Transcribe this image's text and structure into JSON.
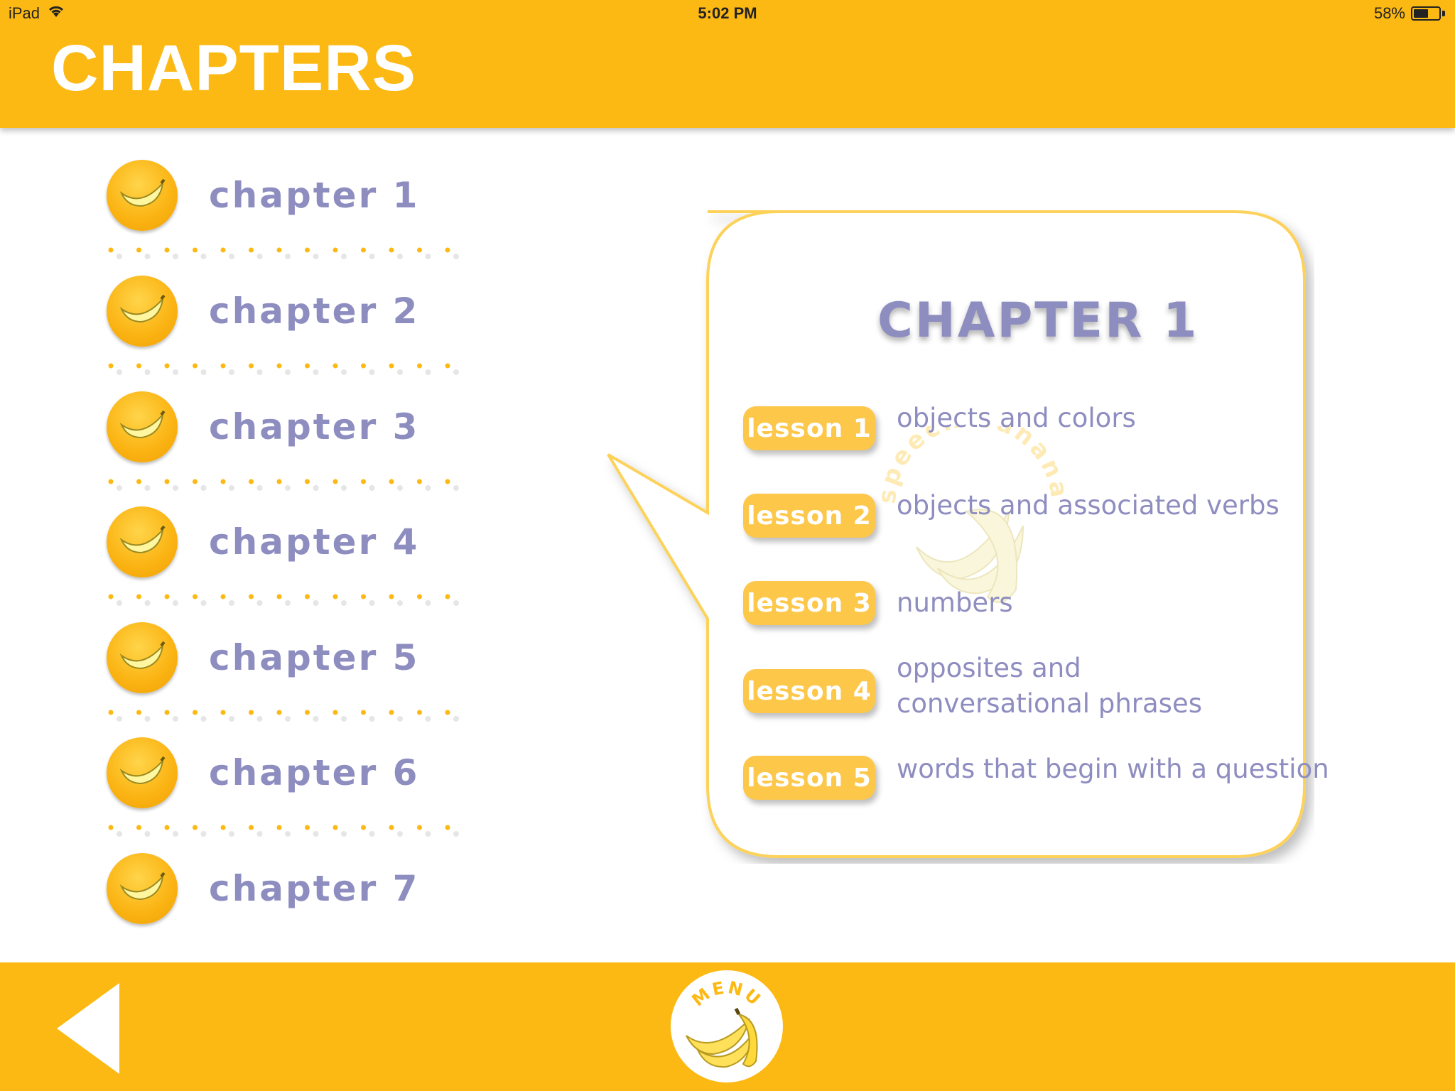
{
  "status_bar": {
    "device": "iPad",
    "time": "5:02 PM",
    "battery": "58%",
    "battery_level": 0.58
  },
  "header": {
    "title": "CHAPTERS",
    "background_color": "#fdb913"
  },
  "chapters": [
    {
      "label": "chapter 1",
      "icon": "banana-icon"
    },
    {
      "label": "chapter 2",
      "icon": "banana-icon"
    },
    {
      "label": "chapter 3",
      "icon": "banana-icon"
    },
    {
      "label": "chapter 4",
      "icon": "banana-icon"
    },
    {
      "label": "chapter 5",
      "icon": "banana-icon"
    },
    {
      "label": "chapter 6",
      "icon": "banana-icon"
    },
    {
      "label": "chapter 7",
      "icon": "banana-icon"
    }
  ],
  "detail": {
    "heading": "CHAPTER 1",
    "watermark_text": "speech banana",
    "lessons": [
      {
        "button": "lesson 1",
        "description": "objects and colors"
      },
      {
        "button": "lesson 2",
        "description": "objects and associated verbs"
      },
      {
        "button": "lesson 3",
        "description": "numbers"
      },
      {
        "button": "lesson 4",
        "description": "opposites and conversational phrases"
      },
      {
        "button": "lesson 5",
        "description": "words that begin with a question"
      }
    ]
  },
  "footer": {
    "menu_label": "MENU",
    "back_icon": "back-arrow-icon"
  },
  "colors": {
    "accent": "#fdb913",
    "lavender_text": "#8e8dc0",
    "lesson_button": "#fdc74a"
  }
}
